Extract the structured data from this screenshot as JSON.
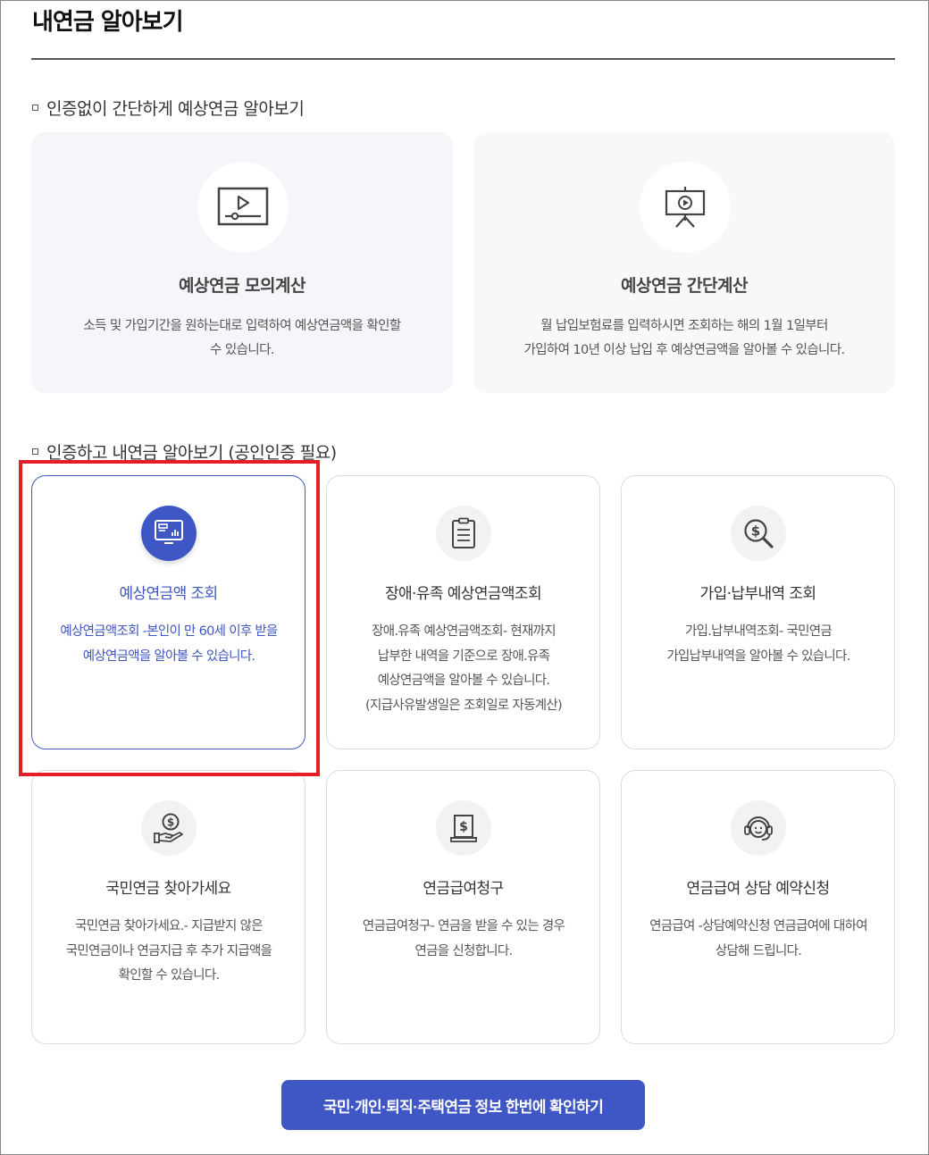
{
  "page": {
    "title": "내연금 알아보기"
  },
  "section_simple": {
    "heading": "인증없이 간단하게 예상연금 알아보기",
    "cards": [
      {
        "title": "예상연금 모의계산",
        "desc_line1": "소득 및 가입기간을 원하는대로 입력하여 예상연금액을 확인할",
        "desc_line2": "수 있습니다.",
        "icon": "video-player-icon"
      },
      {
        "title": "예상연금 간단계산",
        "desc_line1": "월 납입보험료를 입력하시면 조회하는 해의 1월 1일부터",
        "desc_line2": "가입하여 10년 이상 납입 후 예상연금액을 알아볼 수 있습니다.",
        "icon": "presentation-board-icon"
      }
    ]
  },
  "section_auth": {
    "heading": "인증하고 내연금 알아보기 (공인인증 필요)",
    "cards": [
      {
        "title": "예상연금액 조회",
        "desc": [
          "예상연금액조회 -본인이 만 60세 이후 받을",
          "예상연금액을 알아볼 수 있습니다."
        ],
        "icon": "monitor-chart-icon",
        "selected": true
      },
      {
        "title": "장애·유족 예상연금액조회",
        "desc": [
          "장애.유족 예상연금액조회- 현재까지",
          "납부한 내역을 기준으로 장애.유족",
          "예상연금액을 알아볼 수 있습니다.",
          "(지급사유발생일은 조회일로 자동계산)"
        ],
        "icon": "clipboard-icon",
        "selected": false
      },
      {
        "title": "가입·납부내역 조회",
        "desc": [
          "가입.납부내역조회- 국민연금",
          "가입납부내역을 알아볼 수 있습니다."
        ],
        "icon": "dollar-search-icon",
        "selected": false
      },
      {
        "title": "국민연금 찾아가세요",
        "desc": [
          "국민연금 찾아가세요.- 지급받지 않은",
          "국민연금이나 연금지급 후 추가 지급액을",
          "확인할 수 있습니다."
        ],
        "icon": "hand-coin-icon",
        "selected": false
      },
      {
        "title": "연금급여청구",
        "desc": [
          "연금급여청구- 연금을 받을 수 있는 경우",
          "연금을 신청합니다."
        ],
        "icon": "dollar-document-icon",
        "selected": false
      },
      {
        "title": "연금급여 상담 예약신청",
        "desc": [
          "연금급여 -상담예약신청 연금급여에 대하여",
          "상담해 드립니다."
        ],
        "icon": "headset-icon",
        "selected": false
      }
    ]
  },
  "cta": {
    "label": "국민·개인·퇴직·주택연금 정보 한번에 확인하기"
  },
  "colors": {
    "accent": "#3f57c4",
    "highlight": "#e41d26"
  }
}
